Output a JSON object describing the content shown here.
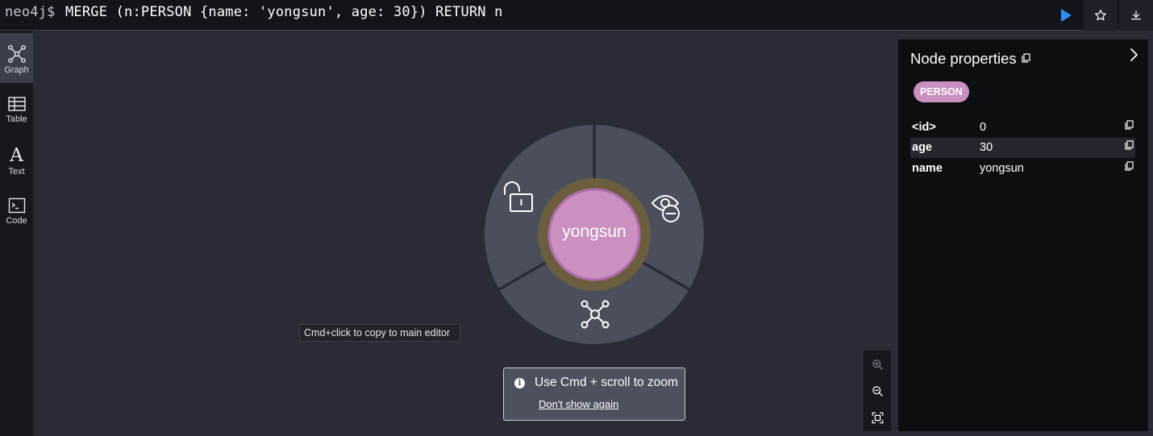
{
  "editor": {
    "prompt": "neo4j$",
    "query": "MERGE (n:PERSON {name: 'yongsun', age: 30}) RETURN n",
    "run_icon": "play-icon",
    "favorite_icon": "star-icon",
    "download_icon": "download-icon"
  },
  "sidebar": {
    "tabs": [
      {
        "label": "Graph",
        "icon": "graph-icon",
        "active": true
      },
      {
        "label": "Table",
        "icon": "table-icon",
        "active": false
      },
      {
        "label": "Text",
        "icon": "text-icon",
        "active": false
      },
      {
        "label": "Code",
        "icon": "code-icon",
        "active": false
      }
    ]
  },
  "graph": {
    "node": {
      "label": "yongsun",
      "color": "#c990c0",
      "ring_color": "#6b5e3e"
    },
    "wheel_actions": [
      {
        "icon": "unlock-icon",
        "action": "unpin node"
      },
      {
        "icon": "hide-node-icon",
        "action": "hide node"
      },
      {
        "icon": "expand-graph-icon",
        "action": "expand / collapse relationships"
      }
    ],
    "tooltip": "Cmd+click to copy to main editor",
    "zoom_hint": {
      "text": "Use Cmd + scroll to zoom",
      "link": "Don't show again"
    },
    "zoom_controls": [
      "zoom-in-icon",
      "zoom-out-icon",
      "fit-to-screen-icon"
    ]
  },
  "properties_panel": {
    "title": "Node properties",
    "label_badge": "PERSON",
    "rows": [
      {
        "key": "<id>",
        "value": "0"
      },
      {
        "key": "age",
        "value": "30"
      },
      {
        "key": "name",
        "value": "yongsun"
      }
    ]
  },
  "colors": {
    "background": "#292c35",
    "run_accent": "#2e8ef2",
    "label_badge": "#c990c0"
  }
}
